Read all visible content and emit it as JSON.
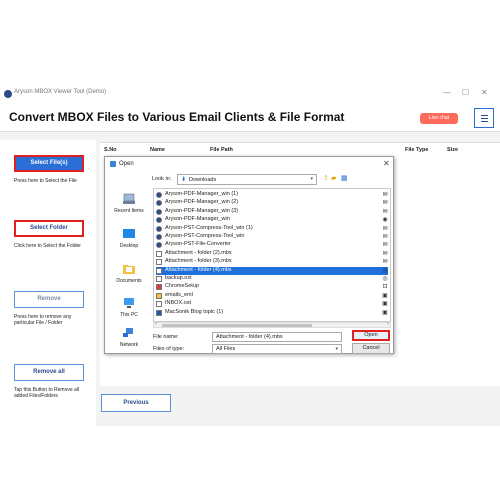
{
  "window": {
    "title": "Aryson MBOX Viewer Tool (Demo)",
    "minimize": "—",
    "maximize": "☐",
    "close": "✕"
  },
  "header": {
    "title": "Convert MBOX Files to Various Email Clients & File Format",
    "live_chat": "Live chat"
  },
  "left": {
    "select_files": "Select File(s)",
    "select_files_help": "Press here to Select the File",
    "select_folder": "Select Folder",
    "select_folder_help": "Click here to Select the Folder",
    "remove": "Remove",
    "remove_help": "Press here to remove any particular File / Folder",
    "remove_all": "Remove all",
    "remove_all_help": "Tap this Button to Remove all added Files/Folders"
  },
  "table": {
    "columns": [
      "S.No",
      "Name",
      "File Path",
      "File Type",
      "Size"
    ]
  },
  "footer": {
    "previous": "Previous"
  },
  "dialog": {
    "title": "Open",
    "look_in_label": "Look in:",
    "look_in_value": "Downloads",
    "places": [
      "Recent Items",
      "Desktop",
      "Documents",
      "This PC",
      "Network"
    ],
    "files": [
      {
        "name": "Aryson-PDF-Manager_win (1)",
        "icon": "app-icon",
        "right_icon": "✉"
      },
      {
        "name": "Aryson-PDF-Manager_win (2)",
        "icon": "app-icon",
        "right_icon": "✉"
      },
      {
        "name": "Aryson-PDF-Manager_win (3)",
        "icon": "app-icon",
        "right_icon": "✉"
      },
      {
        "name": "Aryson-PDF-Manager_win",
        "icon": "app-icon",
        "right_icon": "◉"
      },
      {
        "name": "Aryson-PST-Compress-Tool_win (1)",
        "icon": "app-icon",
        "right_icon": "✉"
      },
      {
        "name": "Aryson-PST-Compress-Tool_win",
        "icon": "app-icon",
        "right_icon": "✉"
      },
      {
        "name": "Aryson-PST-File-Converter",
        "icon": "app-icon",
        "right_icon": "✉"
      },
      {
        "name": "Attachment - folder (2).mbx",
        "icon": "file-icon",
        "right_icon": "✉"
      },
      {
        "name": "Attachment - folder (3).mbx",
        "icon": "file-icon",
        "right_icon": "✉"
      },
      {
        "name": "Attachment - folder (4).mbx",
        "icon": "file-icon",
        "right_icon": "◎",
        "selected": true
      },
      {
        "name": "backup.ost",
        "icon": "file-icon",
        "right_icon": "◎"
      },
      {
        "name": "ChromeSetup",
        "icon": "chrome-icon",
        "right_icon": "⊡"
      },
      {
        "name": "emails_eml",
        "icon": "folder-icon",
        "right_icon": "▣"
      },
      {
        "name": "INBOX.ost",
        "icon": "file-icon",
        "right_icon": "▣"
      },
      {
        "name": "MacSonik Blog topic (1)",
        "icon": "word-icon",
        "right_icon": "▣"
      }
    ],
    "file_name_label": "File name:",
    "file_name_value": "Attachment - folder (4).mbx",
    "files_of_type_label": "Files of type:",
    "files_of_type_value": "All Files",
    "open": "Open",
    "cancel": "Cancel",
    "close": "✕"
  },
  "colors": {
    "accent": "#2a6fd6",
    "highlight": "#e02020",
    "live_chat": "#ff6b5b",
    "selection": "#1e6fd9"
  }
}
